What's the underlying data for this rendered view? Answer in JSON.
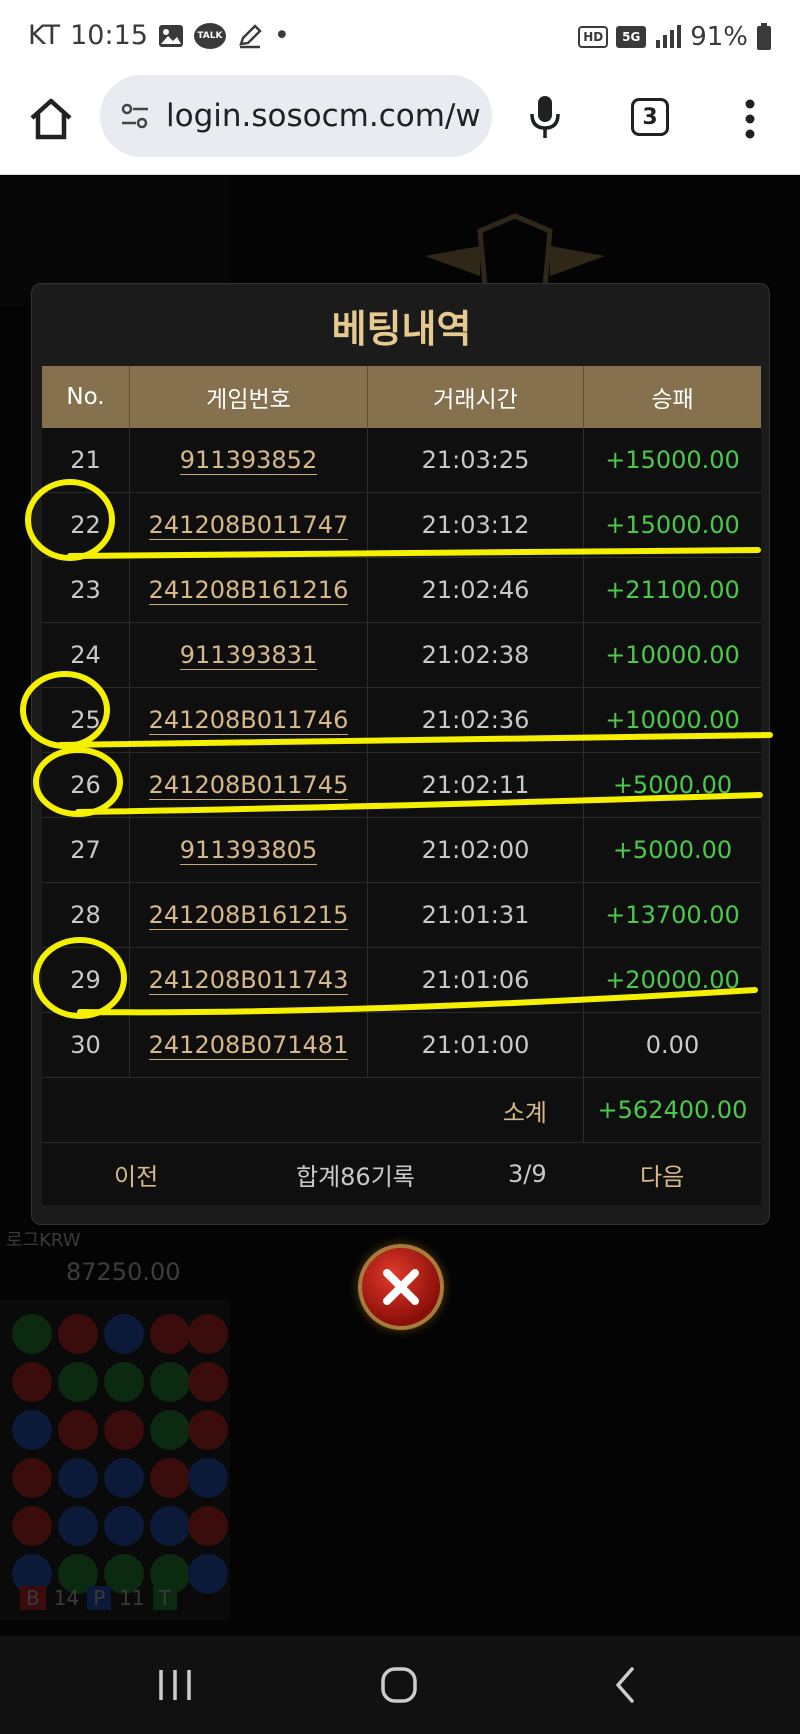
{
  "status_bar": {
    "carrier": "KT",
    "time": "10:15",
    "notif_talk": "TALK",
    "notif_dot": "•",
    "hd": "HD",
    "net": "5G",
    "battery": "91%",
    "icons": [
      "gallery-icon",
      "kakaotalk-icon",
      "pencil-icon",
      "hd-voice-icon",
      "5g-icon",
      "signal-icon",
      "battery-icon"
    ]
  },
  "browser": {
    "url": "login.sosocm.com/w",
    "tab_count": "3"
  },
  "background": {
    "balance_label": "로그KRW",
    "balance": "87250.00",
    "road_footer": {
      "b_label": "B",
      "b_count": "14",
      "p_label": "P",
      "p_count": "11",
      "t_label": "T"
    }
  },
  "modal": {
    "title": "베팅내역",
    "headers": {
      "no": "No.",
      "game": "게임번호",
      "time": "거래시간",
      "result": "승패"
    },
    "rows": [
      {
        "no": "21",
        "game": "911393852",
        "time": "21:03:25",
        "result": "+15000.00"
      },
      {
        "no": "22",
        "game": "241208B011747",
        "time": "21:03:12",
        "result": "+15000.00"
      },
      {
        "no": "23",
        "game": "241208B161216",
        "time": "21:02:46",
        "result": "+21100.00"
      },
      {
        "no": "24",
        "game": "911393831",
        "time": "21:02:38",
        "result": "+10000.00"
      },
      {
        "no": "25",
        "game": "241208B011746",
        "time": "21:02:36",
        "result": "+10000.00"
      },
      {
        "no": "26",
        "game": "241208B011745",
        "time": "21:02:11",
        "result": "+5000.00"
      },
      {
        "no": "27",
        "game": "911393805",
        "time": "21:02:00",
        "result": "+5000.00"
      },
      {
        "no": "28",
        "game": "241208B161215",
        "time": "21:01:31",
        "result": "+13700.00"
      },
      {
        "no": "29",
        "game": "241208B011743",
        "time": "21:01:06",
        "result": "+20000.00"
      },
      {
        "no": "30",
        "game": "241208B071481",
        "time": "21:01:00",
        "result": "0.00"
      }
    ],
    "subtotal_label": "소계",
    "subtotal_value": "+562400.00",
    "pager": {
      "prev": "이전",
      "total": "합계86기록",
      "page": "3/9",
      "next": "다음"
    }
  },
  "colors": {
    "accent_gold": "#e6c98f",
    "header_bg": "#86714e",
    "win_green": "#4cc94c",
    "highlight_yellow": "#f5f000",
    "close_red": "#c8221a"
  }
}
